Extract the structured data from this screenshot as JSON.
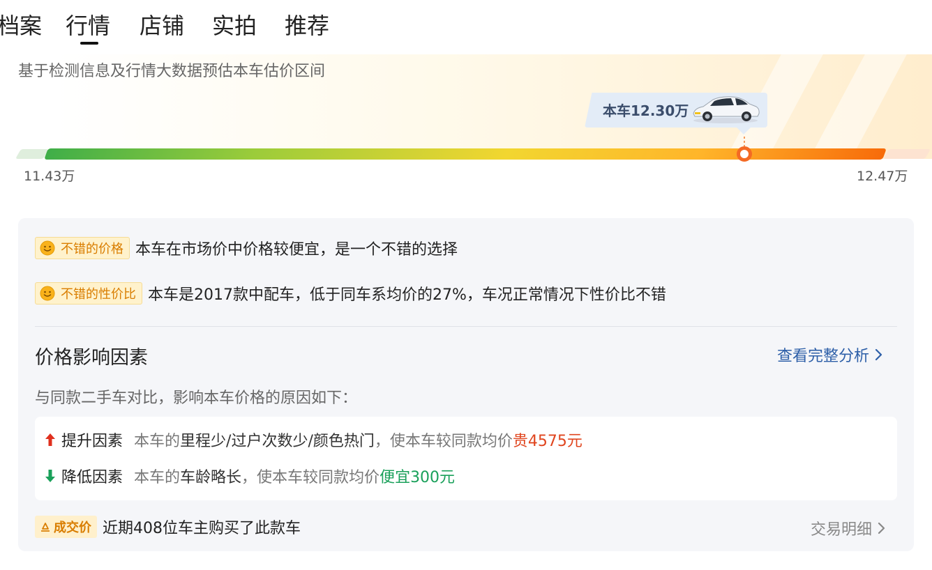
{
  "tabs": [
    {
      "label": "档案"
    },
    {
      "label": "行情",
      "active": true
    },
    {
      "label": "店铺"
    },
    {
      "label": "实拍"
    },
    {
      "label": "推荐"
    }
  ],
  "price_range": {
    "subtitle": "基于检测信息及行情大数据预估本车估价区间",
    "car_tag": "本车12.30万",
    "min_label": "11.43万",
    "max_label": "12.47万",
    "current_position_fraction": 0.836,
    "gradient_colors": [
      "#3fae48",
      "#9ccc3a",
      "#f2d630",
      "#ffb52a",
      "#f76b0a"
    ]
  },
  "verdicts": [
    {
      "badge": "不错的价格",
      "text": "本车在市场价中价格较便宜，是一个不错的选择",
      "icon": "smile-icon"
    },
    {
      "badge": "不错的性价比",
      "text": "本车是2017款中配车，低于同车系均价的27%，车况正常情况下性价比不错",
      "icon": "smile-icon"
    }
  ],
  "factors": {
    "title": "价格影响因素",
    "full_analysis_link": "查看完整分析",
    "intro": "与同款二手车对比，影响本车价格的原因如下：",
    "up": {
      "label": "提升因素",
      "prefix": "本车的",
      "items": "里程少/过户次数少/颜色热门",
      "middle": "，使本车较同款均价",
      "result": "贵4575元"
    },
    "down": {
      "label": "降低因素",
      "prefix": "本车的",
      "items": "车龄略长",
      "middle": "，使本车较同款均价",
      "result": "便宜300元"
    }
  },
  "deal": {
    "badge": "成交价",
    "text": "近期408位车主购买了此款车",
    "detail_link": "交易明细"
  },
  "colors": {
    "accent_orange": "#f46a24",
    "link_blue": "#2d5fa8",
    "up_red": "#e0451e",
    "down_green": "#1aa05a",
    "badge_bg": "#fff2cc"
  }
}
